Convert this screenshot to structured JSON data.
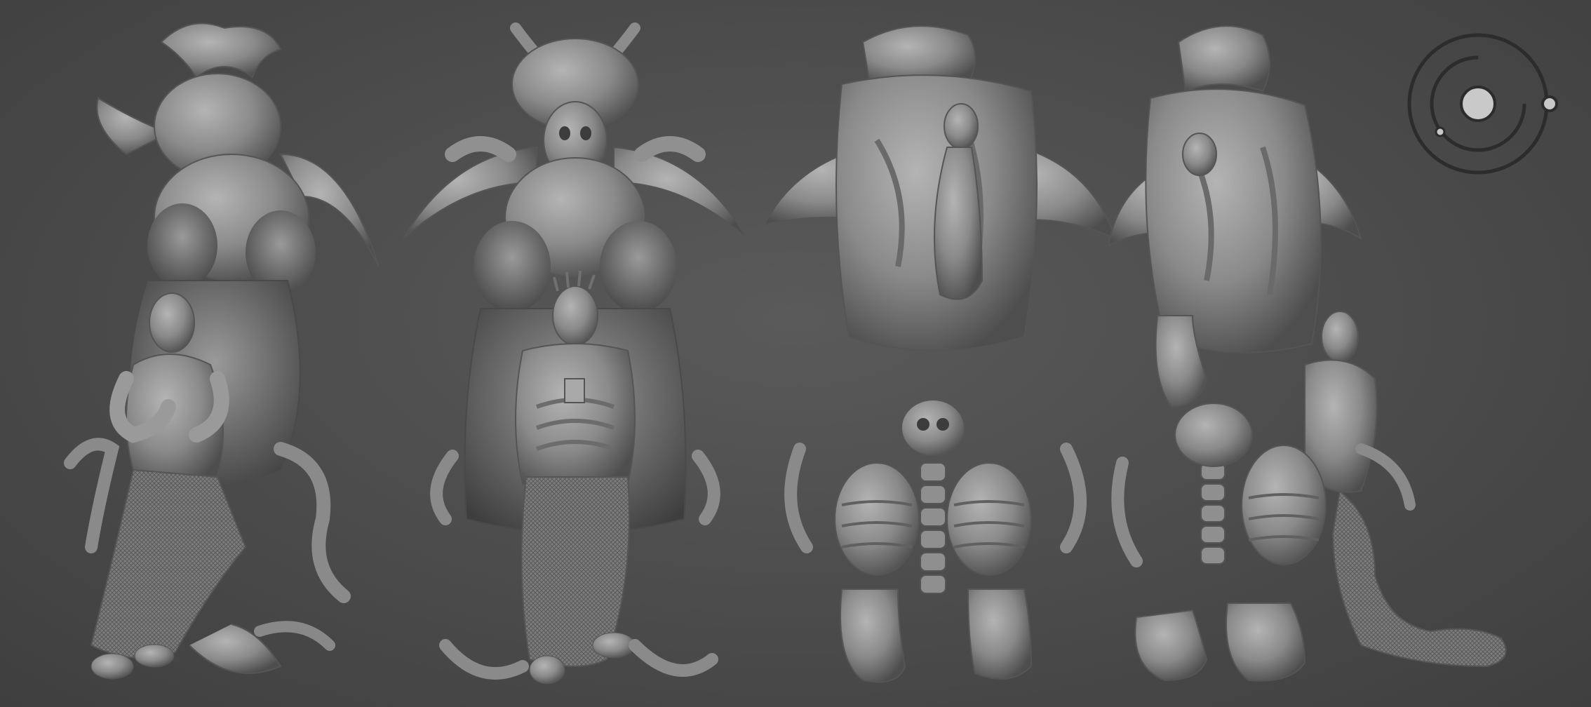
{
  "scene": {
    "background": "#4b4b4b",
    "sculpt_color": "#8c8c8c",
    "views": [
      {
        "name": "three-quarter-left"
      },
      {
        "name": "front"
      },
      {
        "name": "back"
      },
      {
        "name": "three-quarter-right"
      }
    ]
  },
  "gizmo": {
    "icon": "orbit-navigation-icon",
    "ring_color": "#2c2c2c",
    "center_color": "#c9c9c9"
  }
}
